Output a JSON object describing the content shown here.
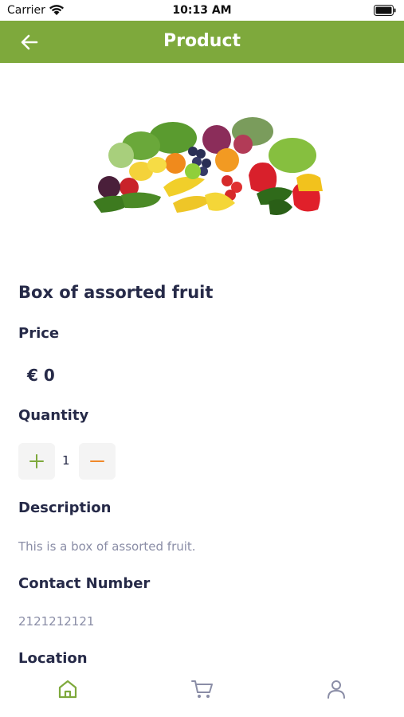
{
  "status": {
    "carrier": "Carrier",
    "time": "10:13 AM"
  },
  "header": {
    "title": "Product",
    "back_icon": "arrow-left-icon"
  },
  "product": {
    "image_icon": "assorted-fruit-vegetables-image",
    "name": "Box of assorted fruit",
    "price_label": "Price",
    "price": "€ 0",
    "quantity_label": "Quantity",
    "quantity": "1",
    "description_label": "Description",
    "description": "This is a box of assorted fruit.",
    "contact_label": "Contact Number",
    "contact": "2121212121",
    "location_label": "Location"
  },
  "tabbar": {
    "items": [
      {
        "icon": "home-icon",
        "active": true
      },
      {
        "icon": "cart-icon",
        "active": false
      },
      {
        "icon": "user-icon",
        "active": false
      }
    ]
  },
  "colors": {
    "accent": "#7ea93c",
    "minus": "#f0892a",
    "text": "#262a48",
    "muted": "#8a8da6"
  }
}
